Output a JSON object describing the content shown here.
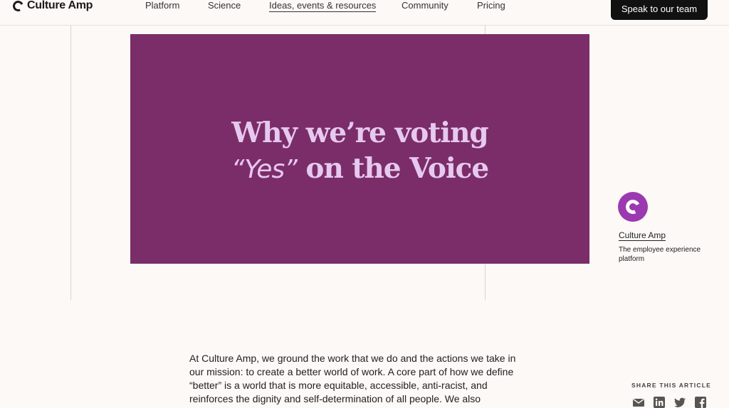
{
  "nav": {
    "brand": "Culture Amp",
    "links": [
      {
        "label": "Platform"
      },
      {
        "label": "Science"
      },
      {
        "label": "Ideas, events & resources"
      },
      {
        "label": "Community"
      },
      {
        "label": "Pricing"
      }
    ],
    "cta_label": "Speak to our team"
  },
  "hero": {
    "title_line1": "Why we’re voting",
    "title_quote_word": "“Yes”",
    "title_line2_rest": " on the Voice",
    "background": "#7b2d69",
    "text_color": "#e6c9ee"
  },
  "author": {
    "name": "Culture Amp",
    "description": "The employee experience platform",
    "avatar_color": "#9b3ab0"
  },
  "article": {
    "intro": "At Culture Amp, we ground the work that we do and the actions we take in our mission: to create a better world of work. A core part of how we define “better” is a world that is more equitable, accessible, anti-racist, and reinforces the dignity and self-determination of all people. We also"
  },
  "share": {
    "label": "SHARE THIS ARTICLE",
    "icons": [
      "email-icon",
      "linkedin-icon",
      "twitter-icon",
      "facebook-icon"
    ]
  }
}
